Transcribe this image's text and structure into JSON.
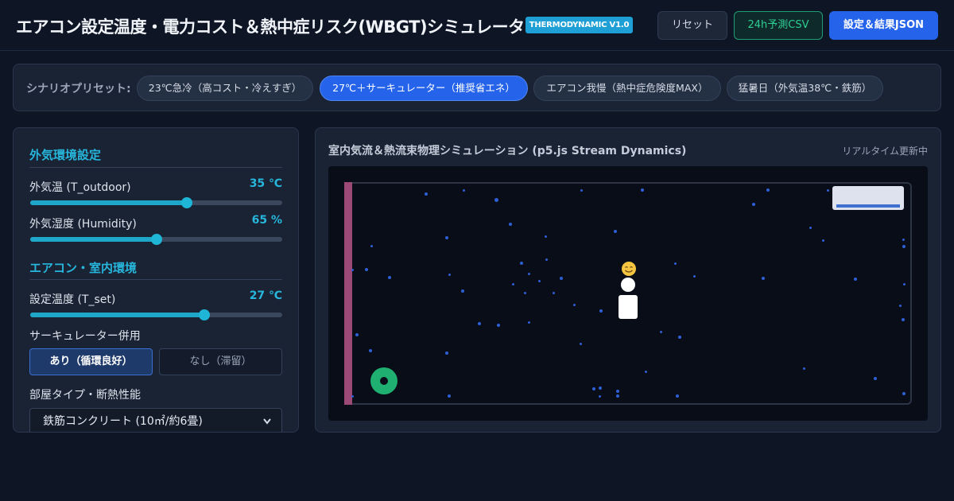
{
  "header": {
    "title": "エアコン設定温度・電力コスト＆熱中症リスク(WBGT)シミュレーター",
    "badge": "THERMODYNAMIC V1.0",
    "reset_label": "リセット",
    "csv_label": "24h予測CSV",
    "json_label": "設定＆結果JSON"
  },
  "presets": {
    "label": "シナリオプリセット:",
    "items": [
      {
        "label": "23℃急冷（高コスト・冷えすぎ）",
        "active": false
      },
      {
        "label": "27℃＋サーキュレーター（推奨省エネ）",
        "active": true
      },
      {
        "label": "エアコン我慢（熱中症危険度MAX）",
        "active": false
      },
      {
        "label": "猛暑日（外気温38℃・鉄筋）",
        "active": false
      }
    ]
  },
  "left_panel": {
    "section1_title": "外気環境設定",
    "outdoor_temp": {
      "label": "外気温 (T_outdoor)",
      "value": "35 ℃",
      "level": 0.62
    },
    "humidity": {
      "label": "外気湿度 (Humidity)",
      "value": "65 %",
      "level": 0.5
    },
    "section2_title": "エアコン・室内環境",
    "set_temp": {
      "label": "設定温度 (T_set)",
      "value": "27 ℃",
      "level": 0.69
    },
    "circulator": {
      "label": "サーキュレーター併用",
      "on_label": "あり（循環良好）",
      "off_label": "なし（滞留）",
      "selected": "on"
    },
    "room_type": {
      "label": "部屋タイプ・断熱性能",
      "selected": "鉄筋コンクリート (10㎡/約6畳)"
    }
  },
  "simulation": {
    "title": "室内気流＆熱流束物理シミュレーション (p5.js Stream Dynamics)",
    "status": "リアルタイム更新中",
    "comfort_emoji": "😊"
  },
  "colors": {
    "accent": "#27b6dc",
    "primary": "#2563eb",
    "csv_green": "#2fce93",
    "window_wall": "#9b4a78",
    "fan": "#1fb071",
    "particle": "#2f5fd6"
  }
}
